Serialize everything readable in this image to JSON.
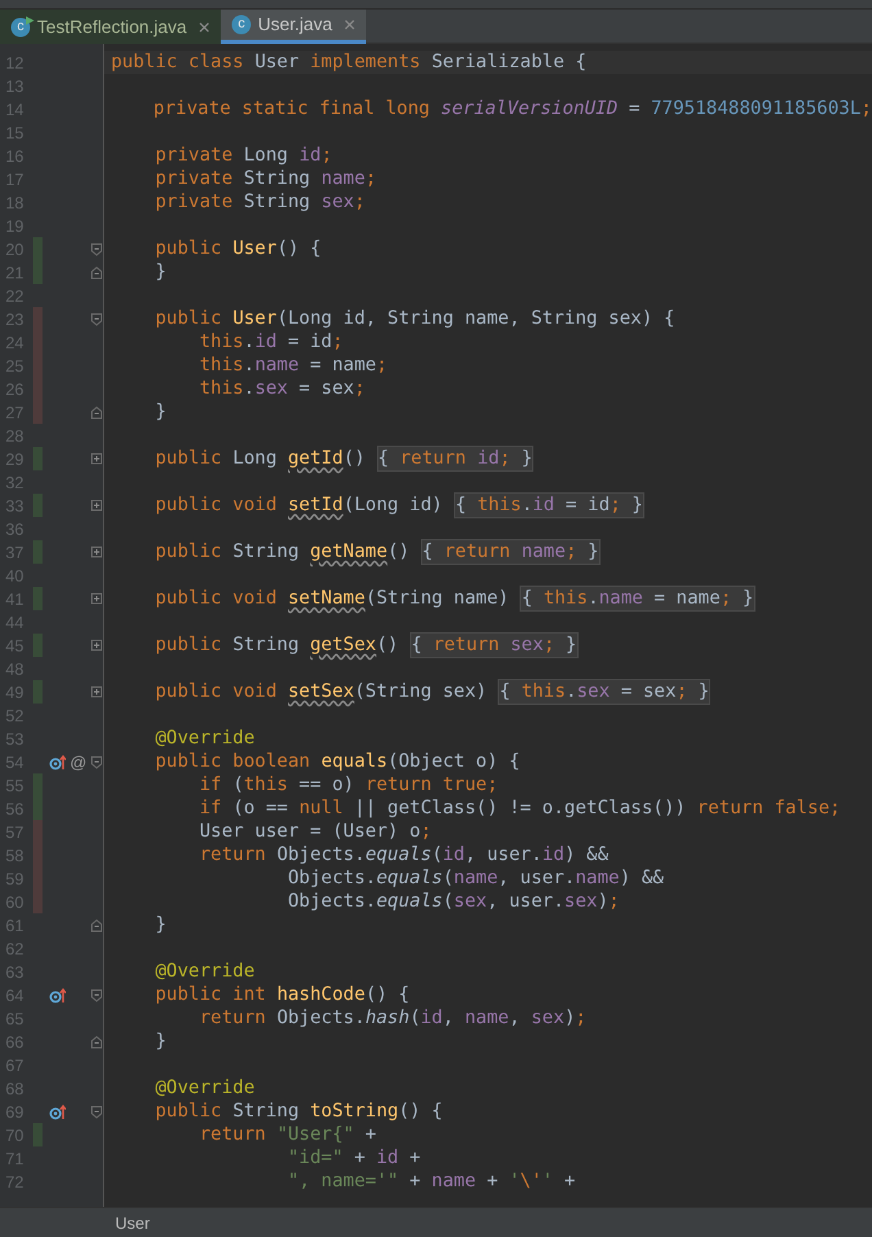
{
  "tabs": [
    {
      "label": "TestReflection.java",
      "selected": false,
      "icon_text": "c",
      "run_marker": true
    },
    {
      "label": "User.java",
      "selected": true,
      "icon_text": "c",
      "run_marker": false
    }
  ],
  "editor": {
    "lines": [
      {
        "number": "12",
        "current": true,
        "tokens": [
          {
            "kind": "kw",
            "text": "public class "
          },
          {
            "kind": "plain",
            "text": "User "
          },
          {
            "kind": "kw",
            "text": "implements "
          },
          {
            "kind": "plain",
            "text": "Serializable {"
          }
        ]
      },
      {
        "number": "13"
      },
      {
        "number": "14",
        "tokens": [
          {
            "kind": "kw",
            "text": "    private static final long "
          },
          {
            "kind": "static_field",
            "text": "serialVersionUID"
          },
          {
            "kind": "plain",
            "text": " = "
          },
          {
            "kind": "number",
            "text": "779518488091185603L"
          },
          {
            "kind": "kw",
            "text": ";"
          }
        ]
      },
      {
        "number": "15"
      },
      {
        "number": "16",
        "tokens": [
          {
            "kind": "kw",
            "text": "    private "
          },
          {
            "kind": "plain",
            "text": "Long "
          },
          {
            "kind": "field",
            "text": "id"
          },
          {
            "kind": "kw",
            "text": ";"
          }
        ]
      },
      {
        "number": "17",
        "tokens": [
          {
            "kind": "kw",
            "text": "    private "
          },
          {
            "kind": "plain",
            "text": "String "
          },
          {
            "kind": "field",
            "text": "name"
          },
          {
            "kind": "kw",
            "text": ";"
          }
        ]
      },
      {
        "number": "18",
        "tokens": [
          {
            "kind": "kw",
            "text": "    private "
          },
          {
            "kind": "plain",
            "text": "String "
          },
          {
            "kind": "field",
            "text": "sex"
          },
          {
            "kind": "kw",
            "text": ";"
          }
        ]
      },
      {
        "number": "19"
      },
      {
        "number": "20",
        "added": true,
        "fold_start": true,
        "tokens": [
          {
            "kind": "kw",
            "text": "    public "
          },
          {
            "kind": "method_decl",
            "text": "User"
          },
          {
            "kind": "plain",
            "text": "() {"
          }
        ]
      },
      {
        "number": "21",
        "added": true,
        "fold_end": true,
        "tokens": [
          {
            "kind": "plain",
            "text": "    }"
          }
        ]
      },
      {
        "number": "22"
      },
      {
        "number": "23",
        "modified": true,
        "fold_start": true,
        "tokens": [
          {
            "kind": "kw",
            "text": "    public "
          },
          {
            "kind": "method_decl",
            "text": "User"
          },
          {
            "kind": "plain",
            "text": "(Long id, String name, String sex) {"
          }
        ]
      },
      {
        "number": "24",
        "modified": true,
        "tokens": [
          {
            "kind": "kw",
            "text": "        this"
          },
          {
            "kind": "plain",
            "text": "."
          },
          {
            "kind": "field",
            "text": "id"
          },
          {
            "kind": "plain",
            "text": " = id"
          },
          {
            "kind": "kw",
            "text": ";"
          }
        ]
      },
      {
        "number": "25",
        "modified": true,
        "tokens": [
          {
            "kind": "kw",
            "text": "        this"
          },
          {
            "kind": "plain",
            "text": "."
          },
          {
            "kind": "field",
            "text": "name"
          },
          {
            "kind": "plain",
            "text": " = name"
          },
          {
            "kind": "kw",
            "text": ";"
          }
        ]
      },
      {
        "number": "26",
        "modified": true,
        "tokens": [
          {
            "kind": "kw",
            "text": "        this"
          },
          {
            "kind": "plain",
            "text": "."
          },
          {
            "kind": "field",
            "text": "sex"
          },
          {
            "kind": "plain",
            "text": " = sex"
          },
          {
            "kind": "kw",
            "text": ";"
          }
        ]
      },
      {
        "number": "27",
        "modified": true,
        "fold_end": true,
        "tokens": [
          {
            "kind": "plain",
            "text": "    }"
          }
        ]
      },
      {
        "number": "28"
      },
      {
        "number": "29",
        "added": true,
        "collapsed": true,
        "tokens": [
          {
            "kind": "kw",
            "text": "    public "
          },
          {
            "kind": "plain",
            "text": "Long "
          },
          {
            "kind": "flagged_method",
            "text": "getId"
          },
          {
            "kind": "plain",
            "text": "() "
          }
        ],
        "folded": [
          {
            "kind": "plain",
            "text": "{ "
          },
          {
            "kind": "kw",
            "text": "return "
          },
          {
            "kind": "field",
            "text": "id"
          },
          {
            "kind": "kw",
            "text": ";"
          },
          {
            "kind": "plain",
            "text": " }"
          }
        ]
      },
      {
        "number": "32"
      },
      {
        "number": "33",
        "added": true,
        "collapsed": true,
        "tokens": [
          {
            "kind": "kw",
            "text": "    public void "
          },
          {
            "kind": "flagged_method",
            "text": "setId"
          },
          {
            "kind": "plain",
            "text": "(Long id) "
          }
        ],
        "folded": [
          {
            "kind": "plain",
            "text": "{ "
          },
          {
            "kind": "kw",
            "text": "this"
          },
          {
            "kind": "plain",
            "text": "."
          },
          {
            "kind": "field",
            "text": "id"
          },
          {
            "kind": "plain",
            "text": " = id"
          },
          {
            "kind": "kw",
            "text": ";"
          },
          {
            "kind": "plain",
            "text": " }"
          }
        ]
      },
      {
        "number": "36"
      },
      {
        "number": "37",
        "added": true,
        "collapsed": true,
        "tokens": [
          {
            "kind": "kw",
            "text": "    public "
          },
          {
            "kind": "plain",
            "text": "String "
          },
          {
            "kind": "flagged_method",
            "text": "getName"
          },
          {
            "kind": "plain",
            "text": "() "
          }
        ],
        "folded": [
          {
            "kind": "plain",
            "text": "{ "
          },
          {
            "kind": "kw",
            "text": "return "
          },
          {
            "kind": "field",
            "text": "name"
          },
          {
            "kind": "kw",
            "text": ";"
          },
          {
            "kind": "plain",
            "text": " }"
          }
        ]
      },
      {
        "number": "40"
      },
      {
        "number": "41",
        "added": true,
        "collapsed": true,
        "tokens": [
          {
            "kind": "kw",
            "text": "    public void "
          },
          {
            "kind": "flagged_method",
            "text": "setName"
          },
          {
            "kind": "plain",
            "text": "(String name) "
          }
        ],
        "folded": [
          {
            "kind": "plain",
            "text": "{ "
          },
          {
            "kind": "kw",
            "text": "this"
          },
          {
            "kind": "plain",
            "text": "."
          },
          {
            "kind": "field",
            "text": "name"
          },
          {
            "kind": "plain",
            "text": " = name"
          },
          {
            "kind": "kw",
            "text": ";"
          },
          {
            "kind": "plain",
            "text": " }"
          }
        ]
      },
      {
        "number": "44"
      },
      {
        "number": "45",
        "added": true,
        "collapsed": true,
        "tokens": [
          {
            "kind": "kw",
            "text": "    public "
          },
          {
            "kind": "plain",
            "text": "String "
          },
          {
            "kind": "flagged_method",
            "text": "getSex"
          },
          {
            "kind": "plain",
            "text": "() "
          }
        ],
        "folded": [
          {
            "kind": "plain",
            "text": "{ "
          },
          {
            "kind": "kw",
            "text": "return "
          },
          {
            "kind": "field",
            "text": "sex"
          },
          {
            "kind": "kw",
            "text": ";"
          },
          {
            "kind": "plain",
            "text": " }"
          }
        ]
      },
      {
        "number": "48"
      },
      {
        "number": "49",
        "added": true,
        "collapsed": true,
        "tokens": [
          {
            "kind": "kw",
            "text": "    public void "
          },
          {
            "kind": "flagged_method",
            "text": "setSex"
          },
          {
            "kind": "plain",
            "text": "(String sex) "
          }
        ],
        "folded": [
          {
            "kind": "plain",
            "text": "{ "
          },
          {
            "kind": "kw",
            "text": "this"
          },
          {
            "kind": "plain",
            "text": "."
          },
          {
            "kind": "field",
            "text": "sex"
          },
          {
            "kind": "plain",
            "text": " = sex"
          },
          {
            "kind": "kw",
            "text": ";"
          },
          {
            "kind": "plain",
            "text": " }"
          }
        ]
      },
      {
        "number": "52"
      },
      {
        "number": "53",
        "tokens": [
          {
            "kind": "annotation",
            "text": "    @Override"
          }
        ]
      },
      {
        "number": "54",
        "fold_start": true,
        "overrides": true,
        "annotation_mark": "@",
        "tokens": [
          {
            "kind": "kw",
            "text": "    public boolean "
          },
          {
            "kind": "method_decl",
            "text": "equals"
          },
          {
            "kind": "plain",
            "text": "(Object o) {"
          }
        ]
      },
      {
        "number": "55",
        "added": true,
        "tokens": [
          {
            "kind": "kw",
            "text": "        if "
          },
          {
            "kind": "plain",
            "text": "("
          },
          {
            "kind": "kw",
            "text": "this"
          },
          {
            "kind": "plain",
            "text": " == o) "
          },
          {
            "kind": "kw",
            "text": "return true;"
          }
        ]
      },
      {
        "number": "56",
        "added": true,
        "tokens": [
          {
            "kind": "kw",
            "text": "        if "
          },
          {
            "kind": "plain",
            "text": "(o == "
          },
          {
            "kind": "kw",
            "text": "null"
          },
          {
            "kind": "plain",
            "text": " || getClass() != o.getClass()) "
          },
          {
            "kind": "kw",
            "text": "return false;"
          }
        ]
      },
      {
        "number": "57",
        "modified": true,
        "tokens": [
          {
            "kind": "plain",
            "text": "        User user = (User) o"
          },
          {
            "kind": "kw",
            "text": ";"
          }
        ]
      },
      {
        "number": "58",
        "modified": true,
        "tokens": [
          {
            "kind": "kw",
            "text": "        return "
          },
          {
            "kind": "plain",
            "text": "Objects."
          },
          {
            "kind": "static_call",
            "text": "equals"
          },
          {
            "kind": "plain",
            "text": "("
          },
          {
            "kind": "field",
            "text": "id"
          },
          {
            "kind": "plain",
            "text": ", user."
          },
          {
            "kind": "field",
            "text": "id"
          },
          {
            "kind": "plain",
            "text": ") &&"
          }
        ]
      },
      {
        "number": "59",
        "modified": true,
        "tokens": [
          {
            "kind": "plain",
            "text": "                Objects."
          },
          {
            "kind": "static_call",
            "text": "equals"
          },
          {
            "kind": "plain",
            "text": "("
          },
          {
            "kind": "field",
            "text": "name"
          },
          {
            "kind": "plain",
            "text": ", user."
          },
          {
            "kind": "field",
            "text": "name"
          },
          {
            "kind": "plain",
            "text": ") &&"
          }
        ]
      },
      {
        "number": "60",
        "modified": true,
        "tokens": [
          {
            "kind": "plain",
            "text": "                Objects."
          },
          {
            "kind": "static_call",
            "text": "equals"
          },
          {
            "kind": "plain",
            "text": "("
          },
          {
            "kind": "field",
            "text": "sex"
          },
          {
            "kind": "plain",
            "text": ", user."
          },
          {
            "kind": "field",
            "text": "sex"
          },
          {
            "kind": "plain",
            "text": ")"
          },
          {
            "kind": "kw",
            "text": ";"
          }
        ]
      },
      {
        "number": "61",
        "fold_end": true,
        "tokens": [
          {
            "kind": "plain",
            "text": "    }"
          }
        ]
      },
      {
        "number": "62"
      },
      {
        "number": "63",
        "tokens": [
          {
            "kind": "annotation",
            "text": "    @Override"
          }
        ]
      },
      {
        "number": "64",
        "fold_start": true,
        "overrides": true,
        "tokens": [
          {
            "kind": "kw",
            "text": "    public int "
          },
          {
            "kind": "method_decl",
            "text": "hashCode"
          },
          {
            "kind": "plain",
            "text": "() {"
          }
        ]
      },
      {
        "number": "65",
        "tokens": [
          {
            "kind": "kw",
            "text": "        return "
          },
          {
            "kind": "plain",
            "text": "Objects."
          },
          {
            "kind": "static_call",
            "text": "hash"
          },
          {
            "kind": "plain",
            "text": "("
          },
          {
            "kind": "field",
            "text": "id"
          },
          {
            "kind": "plain",
            "text": ", "
          },
          {
            "kind": "field",
            "text": "name"
          },
          {
            "kind": "plain",
            "text": ", "
          },
          {
            "kind": "field",
            "text": "sex"
          },
          {
            "kind": "plain",
            "text": ")"
          },
          {
            "kind": "kw",
            "text": ";"
          }
        ]
      },
      {
        "number": "66",
        "fold_end": true,
        "tokens": [
          {
            "kind": "plain",
            "text": "    }"
          }
        ]
      },
      {
        "number": "67"
      },
      {
        "number": "68",
        "tokens": [
          {
            "kind": "annotation",
            "text": "    @Override"
          }
        ]
      },
      {
        "number": "69",
        "fold_start": true,
        "overrides": true,
        "tokens": [
          {
            "kind": "kw",
            "text": "    public "
          },
          {
            "kind": "plain",
            "text": "String "
          },
          {
            "kind": "method_decl",
            "text": "toString"
          },
          {
            "kind": "plain",
            "text": "() {"
          }
        ]
      },
      {
        "number": "70",
        "added": true,
        "tokens": [
          {
            "kind": "kw",
            "text": "        return "
          },
          {
            "kind": "string",
            "text": "\"User{\""
          },
          {
            "kind": "plain",
            "text": " +"
          }
        ]
      },
      {
        "number": "71",
        "tokens": [
          {
            "kind": "string",
            "text": "                \"id=\""
          },
          {
            "kind": "plain",
            "text": " + "
          },
          {
            "kind": "field",
            "text": "id"
          },
          {
            "kind": "plain",
            "text": " +"
          }
        ]
      },
      {
        "number": "72",
        "tokens": [
          {
            "kind": "string",
            "text": "                \", name='\""
          },
          {
            "kind": "plain",
            "text": " + "
          },
          {
            "kind": "field",
            "text": "name"
          },
          {
            "kind": "plain",
            "text": " + "
          },
          {
            "kind": "string",
            "text": "'"
          },
          {
            "kind": "kw",
            "text": "\\'"
          },
          {
            "kind": "string",
            "text": "'"
          },
          {
            "kind": "plain",
            "text": " +"
          }
        ]
      }
    ]
  },
  "status_bar": {
    "breadcrumb": "User"
  }
}
